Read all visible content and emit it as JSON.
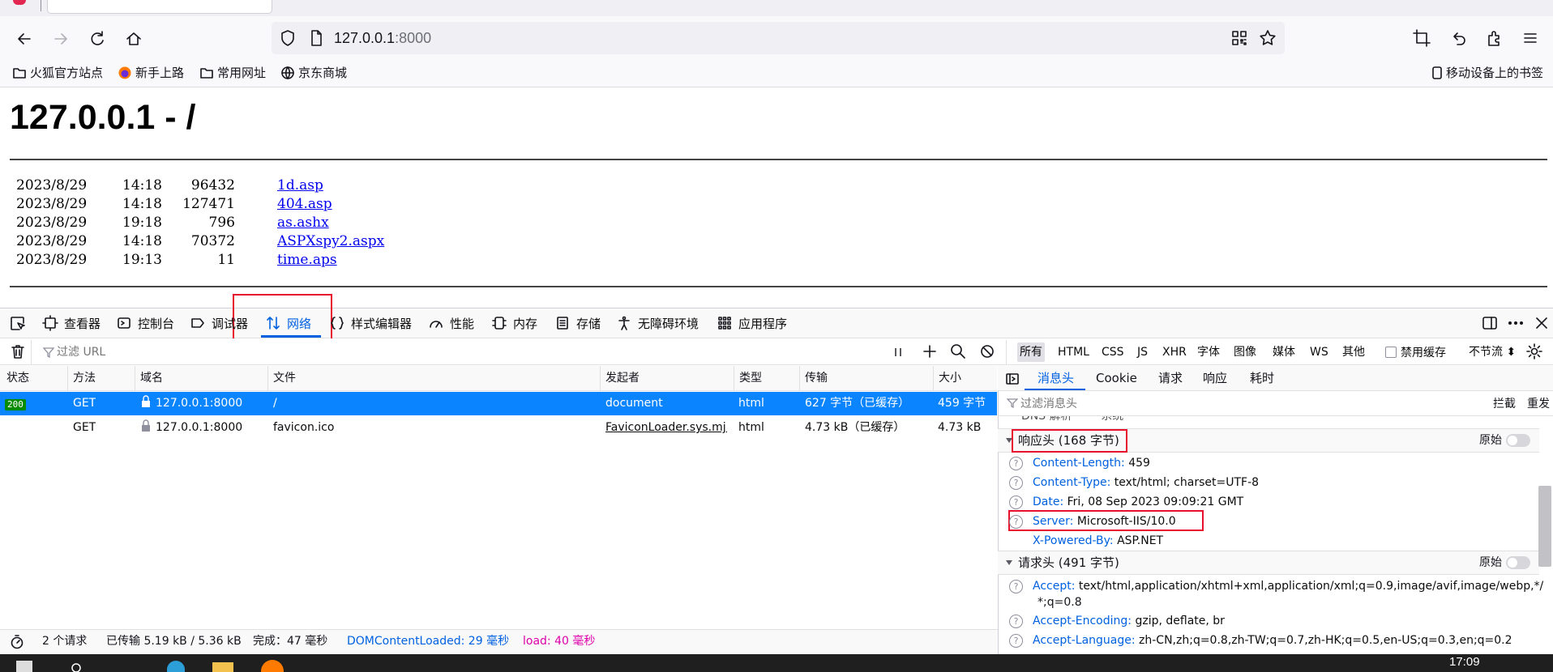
{
  "browser": {
    "url_host": "127.0.0.1",
    "url_port": ":8000",
    "bookmarks": [
      {
        "label": "火狐官方站点",
        "icon": "folder-icon"
      },
      {
        "label": "新手上路",
        "icon": "firefox-icon"
      },
      {
        "label": "常用网址",
        "icon": "folder-icon"
      },
      {
        "label": "京东商城",
        "icon": "globe-icon"
      }
    ],
    "mobile_bookmarks": "移动设备上的书签"
  },
  "page": {
    "title": "127.0.0.1 - /",
    "files": [
      {
        "date": "2023/8/29",
        "time": "14:18",
        "size": "96432",
        "name": "1d.asp"
      },
      {
        "date": "2023/8/29",
        "time": "14:18",
        "size": "127471",
        "name": "404.asp"
      },
      {
        "date": "2023/8/29",
        "time": "19:18",
        "size": "796",
        "name": "as.ashx"
      },
      {
        "date": "2023/8/29",
        "time": "14:18",
        "size": "70372",
        "name": "ASPXspy2.aspx"
      },
      {
        "date": "2023/8/29",
        "time": "19:13",
        "size": "11",
        "name": "time.aps"
      }
    ]
  },
  "devtools": {
    "tabs": [
      "查看器",
      "控制台",
      "调试器",
      "网络",
      "样式编辑器",
      "性能",
      "内存",
      "存储",
      "无障碍环境",
      "应用程序"
    ],
    "selected_tab": "网络",
    "filter_placeholder": "过滤 URL",
    "type_filters": [
      "所有",
      "HTML",
      "CSS",
      "JS",
      "XHR",
      "字体",
      "图像",
      "媒体",
      "WS",
      "其他"
    ],
    "disable_cache": "禁用缓存",
    "throttle": "不节流 ⬍",
    "columns": [
      "状态",
      "方法",
      "域名",
      "文件",
      "发起者",
      "类型",
      "传输",
      "大小"
    ],
    "requests": [
      {
        "status": "200",
        "method": "GET",
        "domain": "127.0.0.1:8000",
        "file": "/",
        "initiator": "document",
        "type": "html",
        "transfer": "627 字节（已缓存）",
        "size": "459 字节"
      },
      {
        "status": "",
        "method": "GET",
        "domain": "127.0.0.1:8000",
        "file": "favicon.ico",
        "initiator": "FaviconLoader.sys.mj...",
        "type": "html",
        "transfer": "4.73 kB（已缓存）",
        "size": "4.73 kB"
      }
    ],
    "status_bar": {
      "requests": "2 个请求",
      "transferred": "已传输 5.19 kB / 5.36 kB",
      "finish": "完成：47 毫秒",
      "dcl": "DOMContentLoaded: 29 毫秒",
      "load": "load: 40 毫秒"
    },
    "side": {
      "tabs": [
        "消息头",
        "Cookie",
        "请求",
        "响应",
        "耗时"
      ],
      "filter_placeholder": "过滤消息头",
      "block": "拦截",
      "resend": "重发",
      "cut_row": "DNS 解析        系统",
      "response_section": "响应头 (168 字节)",
      "request_section": "请求头 (491 字节)",
      "raw": "原始",
      "response_headers": [
        {
          "name": "Content-Length:",
          "value": "459"
        },
        {
          "name": "Content-Type:",
          "value": "text/html; charset=UTF-8"
        },
        {
          "name": "Date:",
          "value": "Fri, 08 Sep 2023 09:09:21 GMT"
        },
        {
          "name": "Server:",
          "value": "Microsoft-IIS/10.0"
        },
        {
          "name": "X-Powered-By:",
          "value": "ASP.NET"
        }
      ],
      "request_headers": [
        {
          "name": "Accept:",
          "value": "text/html,application/xhtml+xml,application/xml;q=0.9,image/avif,image/webp,*/",
          "cont": "*;q=0.8"
        },
        {
          "name": "Accept-Encoding:",
          "value": "gzip, deflate, br"
        },
        {
          "name": "Accept-Language:",
          "value": "zh-CN,zh;q=0.8,zh-TW;q=0.7,zh-HK;q=0.5,en-US;q=0.3,en;q=0.2"
        }
      ]
    }
  },
  "taskbar": {
    "clock": "17:09"
  },
  "colors": {
    "accent": "#0061e0",
    "selected_row": "#0a84ff",
    "highlight_box": "#e8112d",
    "status_ok": "#058b00",
    "load_time": "#dd00a9"
  }
}
